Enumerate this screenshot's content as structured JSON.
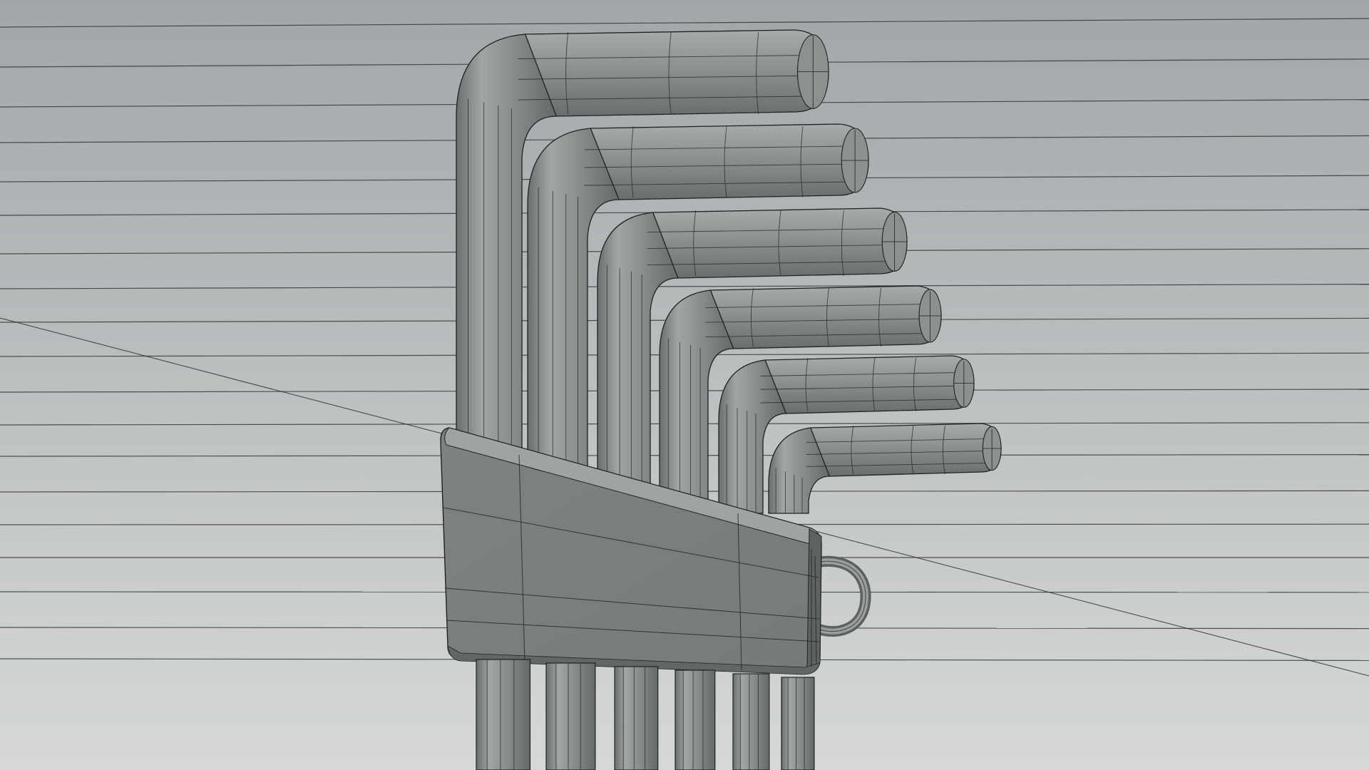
{
  "viewport": {
    "shading_mode": "solid-wireframe-overlay",
    "background_top_color": "#A2A6A8",
    "background_bottom_color": "#D6D8D8",
    "grid_line_color": "#262829",
    "object_color": "#858988",
    "object_highlight_color": "#A3A7A6",
    "object_shadow_color": "#686B6B",
    "wire_color": "#1F2222"
  },
  "model": {
    "object": "hex-key-set",
    "key_count": 6,
    "has_holder": true,
    "has_hanging_loop": true
  }
}
